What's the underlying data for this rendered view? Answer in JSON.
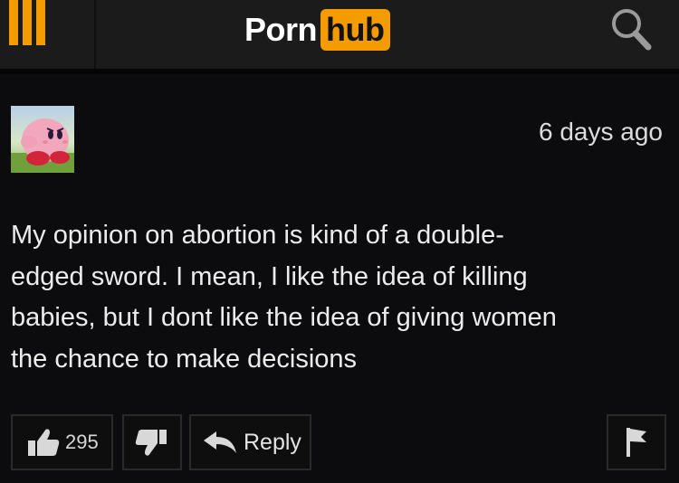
{
  "header": {
    "logo_left": "Porn",
    "logo_right": "hub"
  },
  "comment": {
    "timestamp": "6 days ago",
    "lines": [
      "My opinion on abortion is kind of a double-",
      "edged sword. I mean, I like the idea of killing",
      "babies, but I dont like the idea of giving women",
      "the chance to make decisions"
    ],
    "likes": "295",
    "reply_label": "Reply"
  },
  "colors": {
    "accent": "#f49b00",
    "background": "#0c0b0d",
    "header": "#1b1b1b"
  },
  "icons": [
    "menu-icon",
    "search-icon",
    "thumbs-up-icon",
    "thumbs-down-icon",
    "reply-arrow-icon",
    "flag-icon"
  ]
}
